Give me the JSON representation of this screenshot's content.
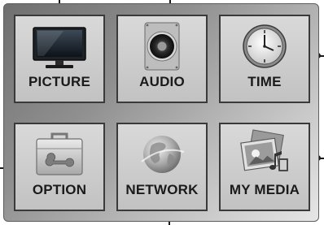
{
  "menu": {
    "tiles": [
      {
        "label": "PICTURE",
        "icon": "monitor-icon"
      },
      {
        "label": "AUDIO",
        "icon": "speaker-icon"
      },
      {
        "label": "TIME",
        "icon": "clock-icon"
      },
      {
        "label": "OPTION",
        "icon": "toolbox-icon"
      },
      {
        "label": "NETWORK",
        "icon": "globe-icon"
      },
      {
        "label": "MY MEDIA",
        "icon": "media-icon"
      }
    ]
  },
  "colors": {
    "tile_border": "#3a3a3a",
    "tile_fill": "#cbcbcb",
    "panel_dark": "#6f6f6f",
    "panel_light": "#e6e6e6",
    "callout": "#1a1a1a"
  }
}
